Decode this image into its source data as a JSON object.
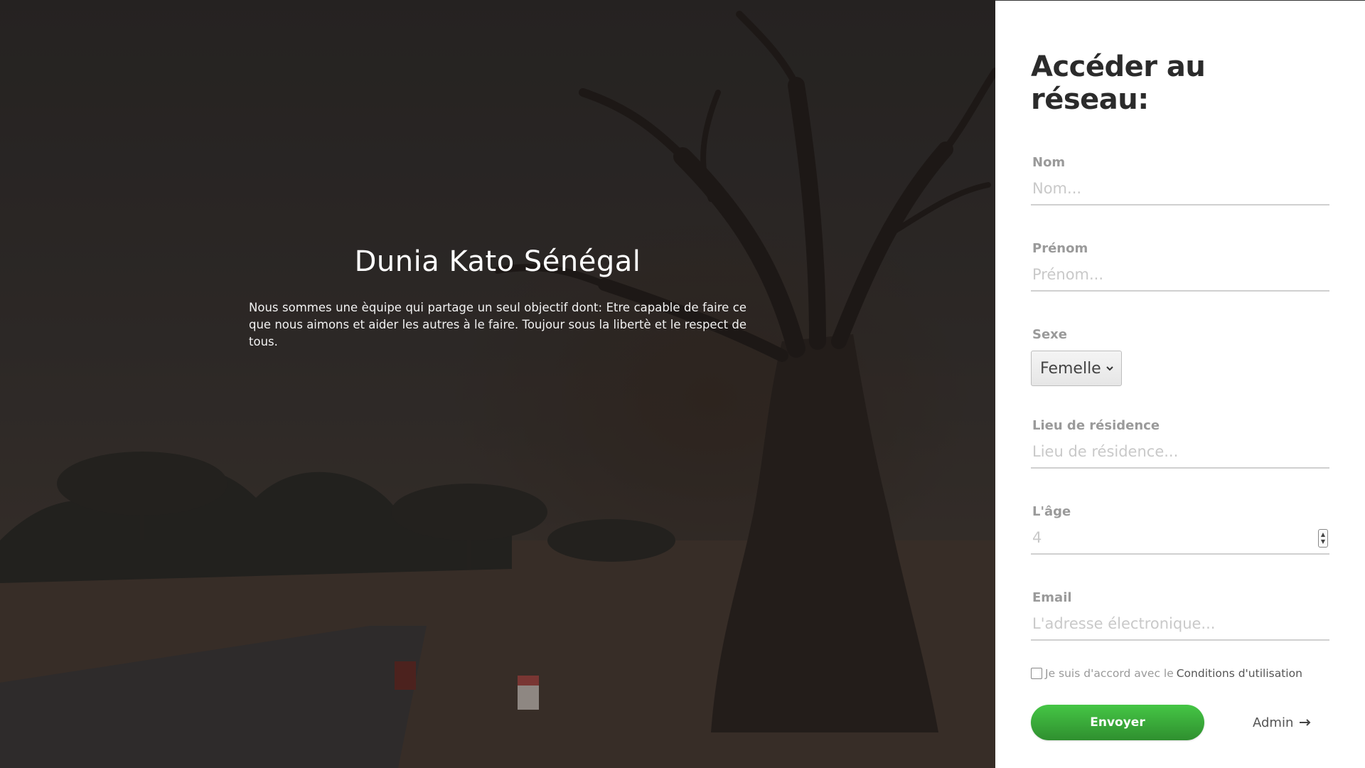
{
  "hero": {
    "title": "Dunia Kato Sénégal",
    "description": "Nous sommes une èquipe qui partage un seul objectif dont: Etre capable de faire ce que nous aimons et aider les autres à le faire. Toujour sous la libertè et le respect de tous."
  },
  "form": {
    "title": "Accéder au réseau:",
    "fields": {
      "nom": {
        "label": "Nom",
        "placeholder": "Nom..."
      },
      "prenom": {
        "label": "Prénom",
        "placeholder": "Prénom..."
      },
      "sexe": {
        "label": "Sexe",
        "value": "Femelle"
      },
      "lieu": {
        "label": "Lieu de résidence",
        "placeholder": "Lieu de résidence..."
      },
      "age": {
        "label": "L'âge",
        "value": "4"
      },
      "email": {
        "label": "Email",
        "placeholder": "L'adresse électronique..."
      }
    },
    "consent": {
      "text": "Je suis d'accord avec le",
      "link": "Conditions d'utilisation"
    },
    "submit_label": "Envoyer",
    "admin_label": "Admin"
  },
  "colors": {
    "accent": "#3aa83a",
    "panel_bg": "#ffffff",
    "label": "#9a9a9a"
  },
  "icons": {
    "select": "chevron-down-icon",
    "admin": "arrow-right-icon"
  }
}
